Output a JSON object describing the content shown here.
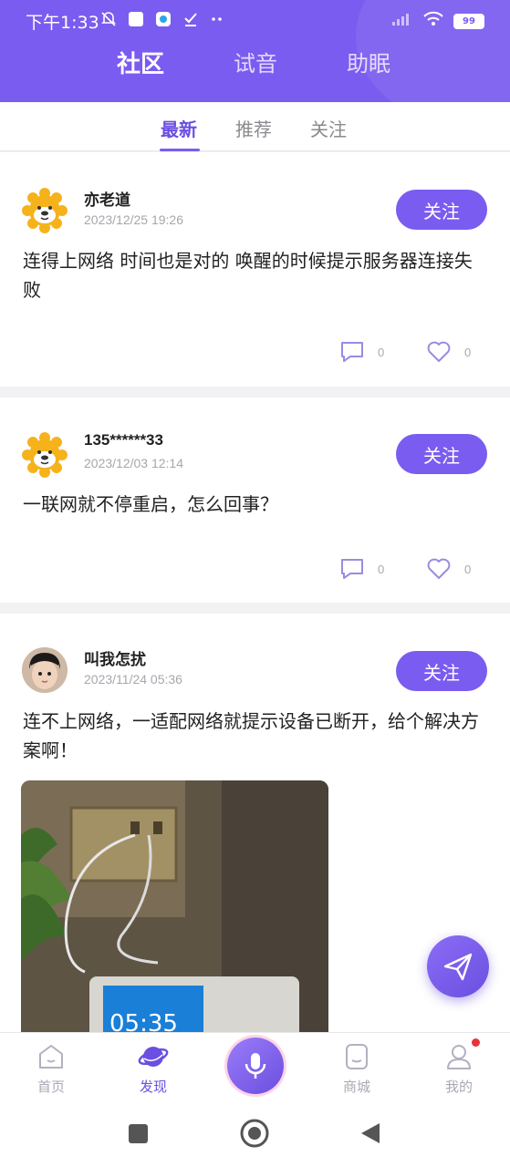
{
  "status_bar": {
    "time": "下午1:33",
    "battery": "99"
  },
  "header": {
    "tabs": [
      {
        "label": "社区",
        "active": true
      },
      {
        "label": "试音",
        "active": false
      },
      {
        "label": "助眠",
        "active": false
      }
    ]
  },
  "sub_tabs": [
    {
      "label": "最新",
      "active": true
    },
    {
      "label": "推荐",
      "active": false
    },
    {
      "label": "关注",
      "active": false
    }
  ],
  "posts": [
    {
      "username": "亦老道",
      "time": "2023/12/25 19:26",
      "follow_label": "关注",
      "content": "连得上网络 时间也是对的 唤醒的时候提示服务器连接失败",
      "comments": "0",
      "likes": "0",
      "avatar": "lion-avatar"
    },
    {
      "username": "135******33",
      "time": "2023/12/03 12:14",
      "follow_label": "关注",
      "content": "一联网就不停重启，怎么回事？",
      "comments": "0",
      "likes": "0",
      "avatar": "lion-avatar"
    },
    {
      "username": "叫我怎扰",
      "time": "2023/11/24 05:36",
      "follow_label": "关注",
      "content": "连不上网络，一适配网络就提示设备已断开，给个解决方案啊！",
      "image_clock": "05:35",
      "avatar": "child-photo-avatar"
    }
  ],
  "bottom_nav": [
    {
      "label": "首页",
      "icon": "home-icon",
      "active": false
    },
    {
      "label": "发现",
      "icon": "planet-icon",
      "active": true
    },
    {
      "label": "",
      "icon": "mic-icon",
      "active": false
    },
    {
      "label": "商城",
      "icon": "shop-icon",
      "active": false
    },
    {
      "label": "我的",
      "icon": "profile-icon",
      "active": false,
      "badge": true
    }
  ],
  "colors": {
    "accent": "#7a5cf0",
    "badge": "#e8333a"
  }
}
